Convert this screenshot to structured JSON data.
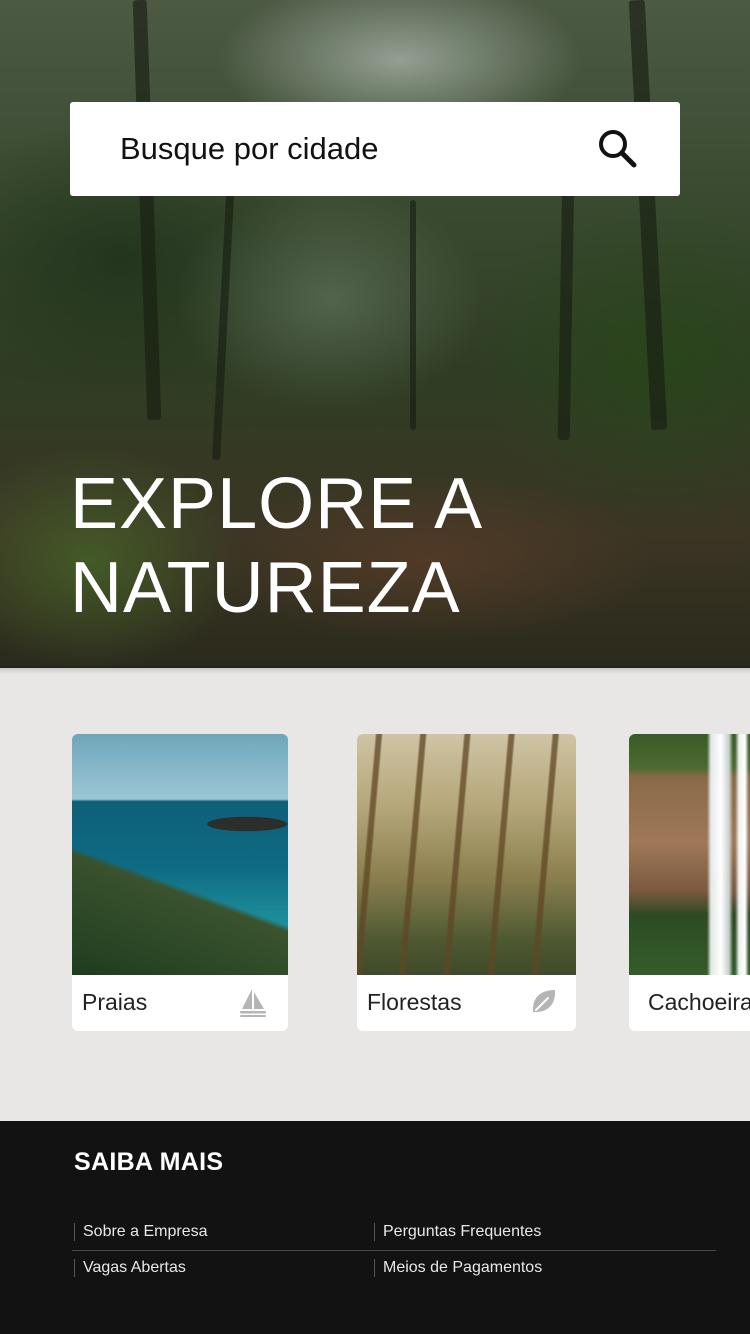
{
  "search": {
    "placeholder": "Busque por cidade",
    "icon": "search-icon"
  },
  "hero": {
    "title": "EXPLORE A\nNATUREZA"
  },
  "categories": [
    {
      "label": "Praias",
      "icon": "sailboat-icon"
    },
    {
      "label": "Florestas",
      "icon": "leaf-icon"
    },
    {
      "label": "Cachoeiras",
      "icon": ""
    }
  ],
  "footer": {
    "title": "SAIBA MAIS",
    "links": [
      "Sobre a Empresa",
      "Perguntas Frequentes",
      "Vagas Abertas",
      "Meios de Pagamentos"
    ]
  },
  "colors": {
    "footer_bg": "#121212",
    "page_bg": "#e9e7e5",
    "icon_gray": "#b5b5b5"
  }
}
